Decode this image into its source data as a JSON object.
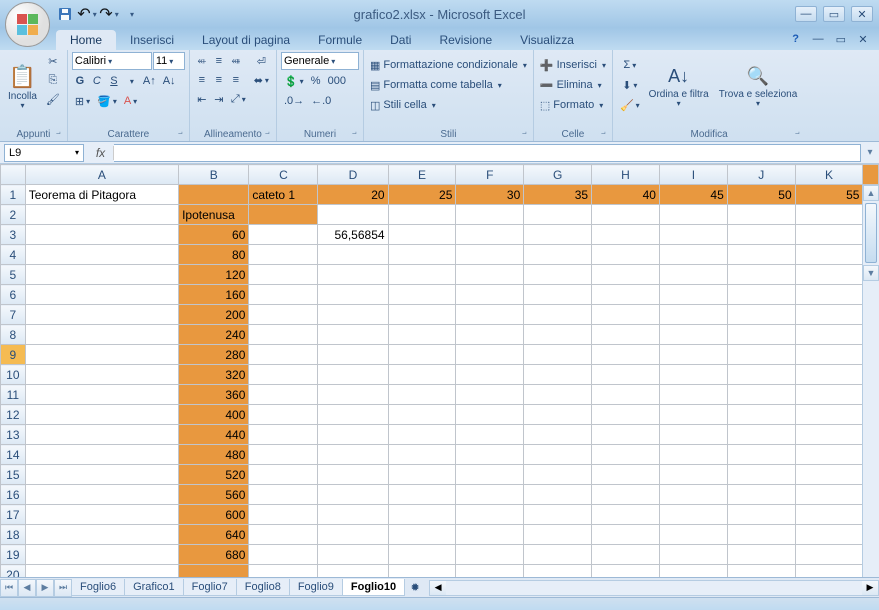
{
  "title": "grafico2.xlsx - Microsoft Excel",
  "tabs": [
    "Home",
    "Inserisci",
    "Layout di pagina",
    "Formule",
    "Dati",
    "Revisione",
    "Visualizza"
  ],
  "active_tab": "Home",
  "ribbon": {
    "appunti": {
      "label": "Appunti",
      "paste": "Incolla"
    },
    "carattere": {
      "label": "Carattere",
      "font": "Calibri",
      "size": "11"
    },
    "allineamento": {
      "label": "Allineamento"
    },
    "numeri": {
      "label": "Numeri",
      "format": "Generale"
    },
    "stili": {
      "label": "Stili",
      "cond": "Formattazione condizionale",
      "table": "Formatta come tabella",
      "cell": "Stili cella"
    },
    "celle": {
      "label": "Celle",
      "insert": "Inserisci",
      "delete": "Elimina",
      "format": "Formato"
    },
    "modifica": {
      "label": "Modifica",
      "sort": "Ordina e filtra",
      "find": "Trova e seleziona"
    }
  },
  "name_box": "L9",
  "columns": [
    "A",
    "B",
    "C",
    "D",
    "E",
    "F",
    "G",
    "H",
    "I",
    "J",
    "K"
  ],
  "rows": [
    1,
    2,
    3,
    4,
    5,
    6,
    7,
    8,
    9,
    10,
    11,
    12,
    13,
    14,
    15,
    16,
    17,
    18,
    19,
    20
  ],
  "selected_row": 9,
  "cells": {
    "A1": "Teorema di Pitagora",
    "C1": "cateto 1",
    "D1": "20",
    "E1": "25",
    "F1": "30",
    "G1": "35",
    "H1": "40",
    "I1": "45",
    "J1": "50",
    "K1": "55",
    "B2": "Ipotenusa",
    "B3": "60",
    "D3": "56,56854",
    "B4": "80",
    "B5": "120",
    "B6": "160",
    "B7": "200",
    "B8": "240",
    "B9": "280",
    "B10": "320",
    "B11": "360",
    "B12": "400",
    "B13": "440",
    "B14": "480",
    "B15": "520",
    "B16": "560",
    "B17": "600",
    "B18": "640",
    "B19": "680"
  },
  "orange_cells": [
    "B1",
    "B2",
    "B3",
    "B4",
    "B5",
    "B6",
    "B7",
    "B8",
    "B9",
    "B10",
    "B11",
    "B12",
    "B13",
    "B14",
    "B15",
    "B16",
    "B17",
    "B18",
    "B19",
    "B20",
    "C1",
    "D1",
    "E1",
    "F1",
    "G1",
    "H1",
    "I1",
    "J1",
    "K1",
    "C2"
  ],
  "sheet_tabs": [
    "Foglio6",
    "Grafico1",
    "Foglio7",
    "Foglio8",
    "Foglio9",
    "Foglio10"
  ],
  "active_sheet": "Foglio10"
}
